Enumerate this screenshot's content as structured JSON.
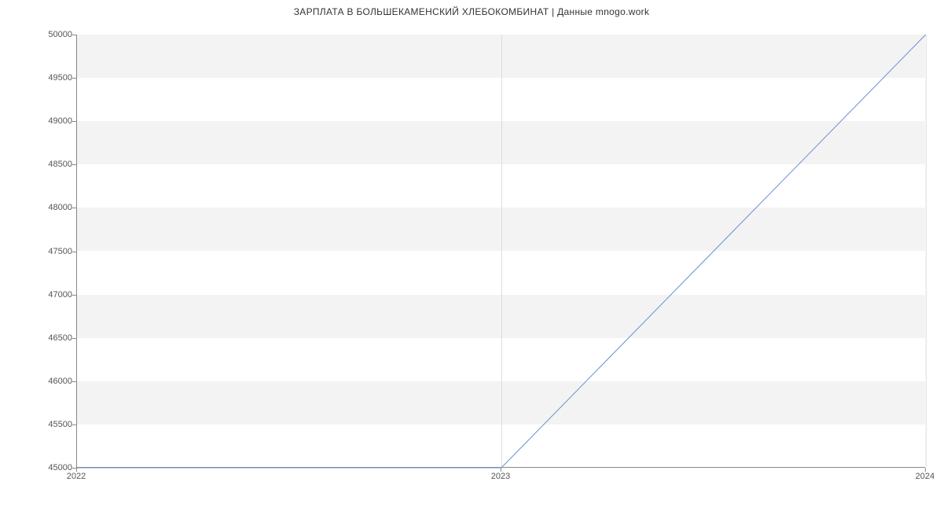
{
  "chart_data": {
    "type": "line",
    "title": "ЗАРПЛАТА В БОЛЬШЕКАМЕНСКИЙ ХЛЕБОКОМБИНАТ | Данные mnogo.work",
    "x": [
      2022,
      2023,
      2024
    ],
    "values": [
      45000,
      45000,
      50000
    ],
    "xlabel": "",
    "ylabel": "",
    "x_ticks": [
      2022,
      2023,
      2024
    ],
    "y_ticks": [
      45000,
      45500,
      46000,
      46500,
      47000,
      47500,
      48000,
      48500,
      49000,
      49500,
      50000
    ],
    "xlim": [
      2022,
      2024
    ],
    "ylim": [
      45000,
      50000
    ],
    "line_color": "#6a8fd4"
  }
}
